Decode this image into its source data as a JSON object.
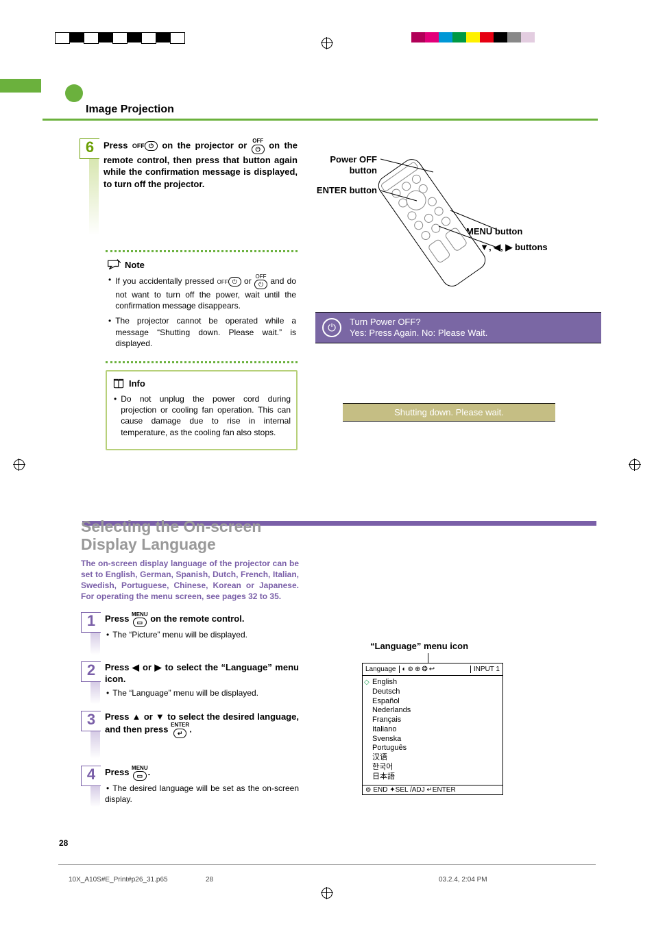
{
  "header": {
    "title": "Image Projection"
  },
  "step6": {
    "num": "6",
    "text_a": "Press ",
    "icon1_label": "OFF",
    "text_b": " on the projector or ",
    "icon2_label": "OFF",
    "text_c": " on the remote control, then press that button again while the confirmation message is displayed, to turn off the projector."
  },
  "note": {
    "heading": "Note",
    "b1_a": "If you accidentally pressed ",
    "b1_off1": "OFF",
    "b1_b": " or ",
    "b1_off2": "OFF",
    "b1_c": " and do not want to turn off the power, wait until the confirmation message disappears.",
    "b2": "The projector cannot be operated while a message “Shutting down. Please wait.” is displayed."
  },
  "info": {
    "heading": "Info",
    "b1": "Do not unplug the power cord during projection or cooling fan operation. This can cause damage due to rise in internal temperature, as the cooling fan also stops."
  },
  "section2": {
    "title": "Selecting the On-screen Display Language",
    "intro": "The on-screen display language of the projector can be set to English, German, Spanish, Dutch, French, Italian, Swedish, Portuguese, Chinese, Korean or Japanese. For operating the menu screen, see pages 32 to 35."
  },
  "pstep1": {
    "num": "1",
    "a": "Press ",
    "icon_label": "MENU",
    "b": " on the remote control.",
    "bullet": "The “Picture” menu will be displayed."
  },
  "pstep2": {
    "num": "2",
    "a": "Press ",
    "b": " or ",
    "c": " to select the “Language” menu icon.",
    "bullet": "The “Language” menu will be displayed."
  },
  "pstep3": {
    "num": "3",
    "a": "Press ",
    "b": " or ",
    "c": " to select the desired language, and then press ",
    "icon_label": "ENTER",
    "d": "."
  },
  "pstep4": {
    "num": "4",
    "a": "Press ",
    "icon_label": "MENU",
    "b": ".",
    "bullet": "The desired language will be set as the on-screen display."
  },
  "right": {
    "label_power": "Power OFF button",
    "label_enter": "ENTER button",
    "label_menu": "MENU button",
    "label_arrows": "▲, ▼, ◀, ▶ buttons"
  },
  "osd1": {
    "line1": "Turn Power OFF?",
    "line2": "Yes: Press Again.  No: Please Wait."
  },
  "osd2": {
    "text": "Shutting down. Please wait."
  },
  "lang_menu": {
    "caption": "“Language” menu icon",
    "title": "Language",
    "input": "INPUT  1",
    "items": [
      "English",
      "Deutsch",
      "Español",
      "Nederlands",
      "Français",
      "Italiano",
      "Svenska",
      "Português",
      "汉语",
      "한국어",
      "日本語"
    ],
    "footer": "END  ✦SEL  /ADJ  ↵ENTER"
  },
  "footer": {
    "page": "28",
    "file": "10X_A10S#E_Print#p26_31.p65",
    "pg": "28",
    "date": "03.2.4, 2:04 PM"
  },
  "colors": {
    "cmyk_left": [
      "#fff",
      "#000",
      "#fff",
      "#000",
      "#fff",
      "#000",
      "#fff",
      "#000",
      "#fff"
    ],
    "cmyk_right": [
      "#b10058",
      "#e20079",
      "#0097d6",
      "#009944",
      "#fff100",
      "#e60012",
      "#000",
      "#888",
      "#e3cde0"
    ]
  }
}
